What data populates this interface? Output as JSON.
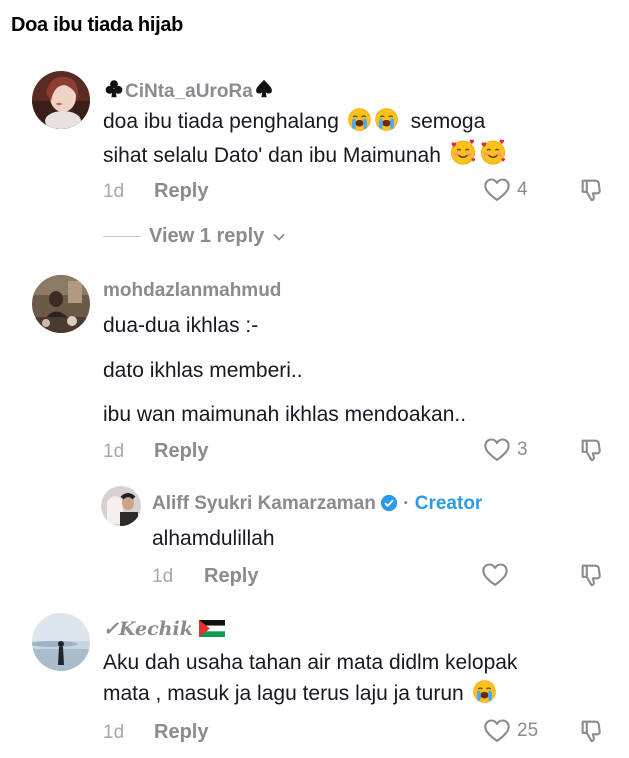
{
  "page_title": "Doa ibu tiada hijab",
  "comments": [
    {
      "username": "CiNta_aUroRa",
      "lines": [
        "doa ibu tiada penghalang",
        "semoga",
        "sihat selalu Dato' dan ibu Maimunah"
      ],
      "age": "1d",
      "reply_label": "Reply",
      "likes": "4",
      "view_replies": "View 1 reply"
    },
    {
      "username": "mohdazlanmahmud",
      "lines": [
        "dua-dua ikhlas :-",
        "dato ikhlas memberi..",
        "ibu wan maimunah ikhlas mendoakan.."
      ],
      "age": "1d",
      "reply_label": "Reply",
      "likes": "3"
    },
    {
      "username": "Aliff Syukri Kamarzaman",
      "separator": " · ",
      "creator_label": "Creator",
      "lines": [
        "alhamdulillah"
      ],
      "age": "1d",
      "reply_label": "Reply",
      "likes": ""
    },
    {
      "username": "✓Kechik",
      "lines": [
        "Aku dah usaha tahan air mata didlm kelopak",
        "mata , masuk ja lagu terus laju ja turun"
      ],
      "age": "1d",
      "reply_label": "Reply",
      "likes": "25"
    }
  ],
  "icons": {
    "like": "heart-outline-icon",
    "dislike": "thumbs-down-outline-icon",
    "view_more": "chevron-down-icon",
    "verified": "verified-badge-icon",
    "crying": "loudly-crying-face-emoji",
    "hearts": "smiling-face-with-hearts-emoji",
    "flag": "palestine-flag-emoji",
    "club": "club-suit",
    "spade": "spade-suit"
  },
  "colors": {
    "text": "#161823",
    "muted": "#8a8b91",
    "creator": "#2c9ae8"
  }
}
